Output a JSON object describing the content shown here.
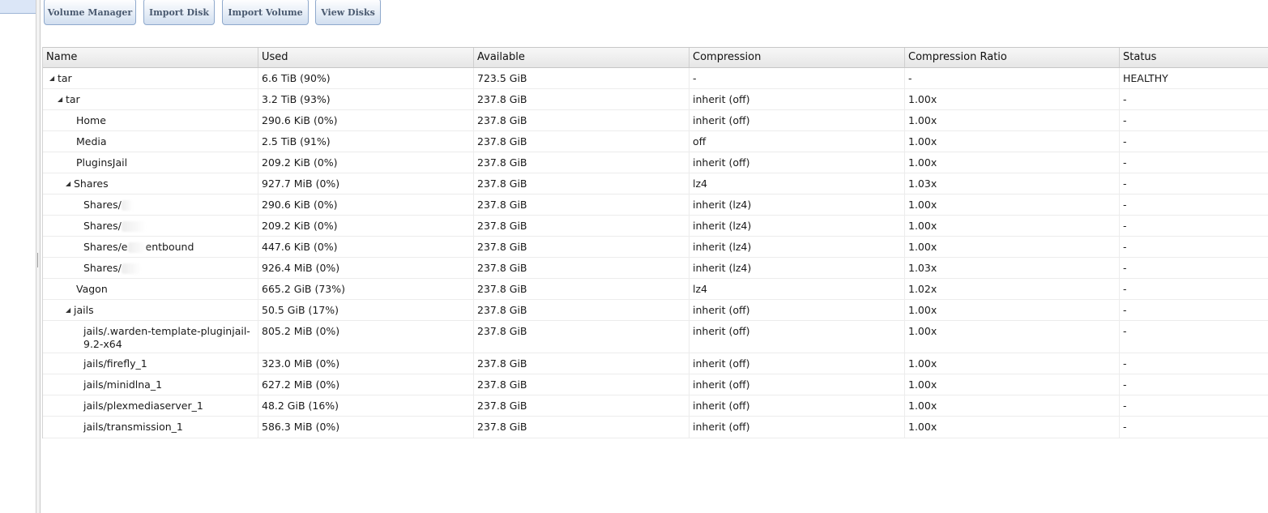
{
  "toolbar": {
    "volume_manager": "Volume Manager",
    "import_disk": "Import Disk",
    "import_volume": "Import Volume",
    "view_disks": "View Disks"
  },
  "columns": [
    "Name",
    "Used",
    "Available",
    "Compression",
    "Compression Ratio",
    "Status"
  ],
  "rows": [
    {
      "name": "tar",
      "used": "6.6 TiB (90%)",
      "available": "723.5 GiB",
      "compression": "-",
      "ratio": "-",
      "status": "HEALTHY"
    },
    {
      "name": "tar",
      "used": "3.2 TiB (93%)",
      "available": "237.8 GiB",
      "compression": "inherit (off)",
      "ratio": "1.00x",
      "status": "-"
    },
    {
      "name": "Home",
      "used": "290.6 KiB (0%)",
      "available": "237.8 GiB",
      "compression": "inherit (off)",
      "ratio": "1.00x",
      "status": "-"
    },
    {
      "name": "Media",
      "used": "2.5 TiB (91%)",
      "available": "237.8 GiB",
      "compression": "off",
      "ratio": "1.00x",
      "status": "-"
    },
    {
      "name": "PluginsJail",
      "used": "209.2 KiB (0%)",
      "available": "237.8 GiB",
      "compression": "inherit (off)",
      "ratio": "1.00x",
      "status": "-"
    },
    {
      "name": "Shares",
      "used": "927.7 MiB (0%)",
      "available": "237.8 GiB",
      "compression": "lz4",
      "ratio": "1.03x",
      "status": "-"
    },
    {
      "name": "Shares/",
      "used": "290.6 KiB (0%)",
      "available": "237.8 GiB",
      "compression": "inherit (lz4)",
      "ratio": "1.00x",
      "status": "-"
    },
    {
      "name": "Shares/",
      "used": "209.2 KiB (0%)",
      "available": "237.8 GiB",
      "compression": "inherit (lz4)",
      "ratio": "1.00x",
      "status": "-"
    },
    {
      "name": "Shares/e",
      "name_suffix": "entbound",
      "used": "447.6 KiB (0%)",
      "available": "237.8 GiB",
      "compression": "inherit (lz4)",
      "ratio": "1.00x",
      "status": "-"
    },
    {
      "name": "Shares/",
      "used": "926.4 MiB (0%)",
      "available": "237.8 GiB",
      "compression": "inherit (lz4)",
      "ratio": "1.03x",
      "status": "-"
    },
    {
      "name": "Vagon",
      "used": "665.2 GiB (73%)",
      "available": "237.8 GiB",
      "compression": "lz4",
      "ratio": "1.02x",
      "status": "-"
    },
    {
      "name": "jails",
      "used": "50.5 GiB (17%)",
      "available": "237.8 GiB",
      "compression": "inherit (off)",
      "ratio": "1.00x",
      "status": "-"
    },
    {
      "name": "jails/.warden-template-pluginjail-9.2-x64",
      "used": "805.2 MiB (0%)",
      "available": "237.8 GiB",
      "compression": "inherit (off)",
      "ratio": "1.00x",
      "status": "-"
    },
    {
      "name": "jails/firefly_1",
      "used": "323.0 MiB (0%)",
      "available": "237.8 GiB",
      "compression": "inherit (off)",
      "ratio": "1.00x",
      "status": "-"
    },
    {
      "name": "jails/minidlna_1",
      "used": "627.2 MiB (0%)",
      "available": "237.8 GiB",
      "compression": "inherit (off)",
      "ratio": "1.00x",
      "status": "-"
    },
    {
      "name": "jails/plexmediaserver_1",
      "used": "48.2 GiB (16%)",
      "available": "237.8 GiB",
      "compression": "inherit (off)",
      "ratio": "1.00x",
      "status": "-"
    },
    {
      "name": "jails/transmission_1",
      "used": "586.3 MiB (0%)",
      "available": "237.8 GiB",
      "compression": "inherit (off)",
      "ratio": "1.00x",
      "status": "-"
    }
  ]
}
